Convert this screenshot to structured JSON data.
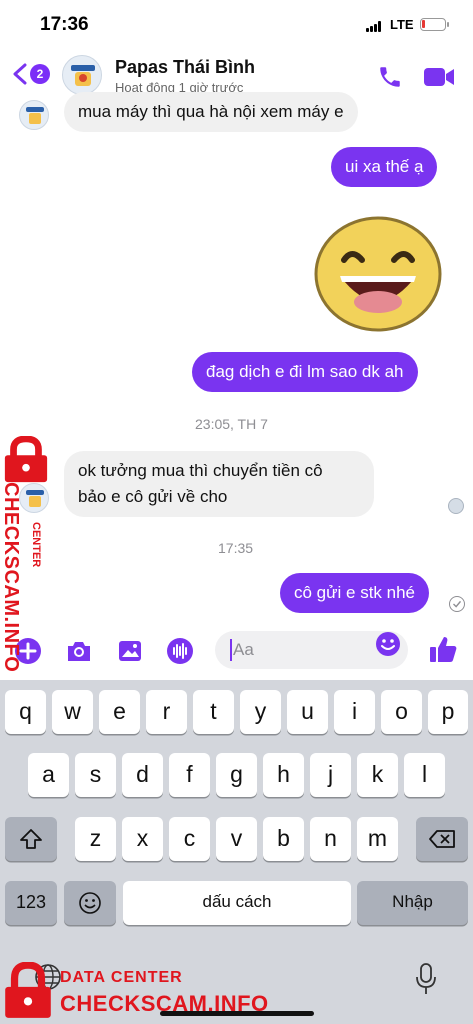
{
  "status_bar": {
    "time": "17:36",
    "network": "LTE"
  },
  "header": {
    "back_badge": "2",
    "contact_name": "Papas Thái Bình",
    "contact_status": "Hoạt động 1 giờ trước"
  },
  "messages": [
    {
      "text": "mua máy thì qua hà nội xem máy e",
      "direction": "incoming"
    },
    {
      "text": "ui xa thế ạ",
      "direction": "outgoing"
    },
    {
      "text": "đag dịch e đi lm sao dk ah",
      "direction": "outgoing"
    },
    {
      "text": "ok tưởng mua thì chuyển tiền cô",
      "direction": "incoming"
    },
    {
      "text": "bảo e cô gửi về cho",
      "direction": "incoming"
    },
    {
      "text": "cô gửi e stk nhé",
      "direction": "outgoing"
    }
  ],
  "timestamps": [
    "23:05, TH 7",
    "17:35"
  ],
  "composer": {
    "placeholder": "Aa"
  },
  "keyboard": {
    "row1": [
      "q",
      "w",
      "e",
      "r",
      "t",
      "y",
      "u",
      "i",
      "o",
      "p"
    ],
    "row2": [
      "a",
      "s",
      "d",
      "f",
      "g",
      "h",
      "j",
      "k",
      "l"
    ],
    "row3": [
      "z",
      "x",
      "c",
      "v",
      "b",
      "n",
      "m"
    ],
    "numbers_key": "123",
    "space_label": "dấu cách",
    "return_label": "Nhập"
  },
  "watermark": {
    "side_brand": "CHECKSCAM.INFO",
    "side_tag": "CENTER",
    "bottom_title": "DATA CENTER",
    "bottom_brand": "CHECKSCAM.INFO"
  },
  "colors": {
    "accent": "#7a34f0",
    "incoming_bubble": "#f0f0f0",
    "watermark": "#e0161e",
    "keyboard_bg": "#d3d6dc"
  },
  "icons": [
    "back-chevron-icon",
    "phone-icon",
    "video-camera-icon",
    "plus-icon",
    "camera-icon",
    "image-icon",
    "microphone-wave-icon",
    "smiley-icon",
    "thumbs-up-icon",
    "shift-icon",
    "backspace-icon",
    "emoji-keyboard-icon",
    "globe-icon",
    "dictation-mic-icon",
    "lock-icon"
  ]
}
